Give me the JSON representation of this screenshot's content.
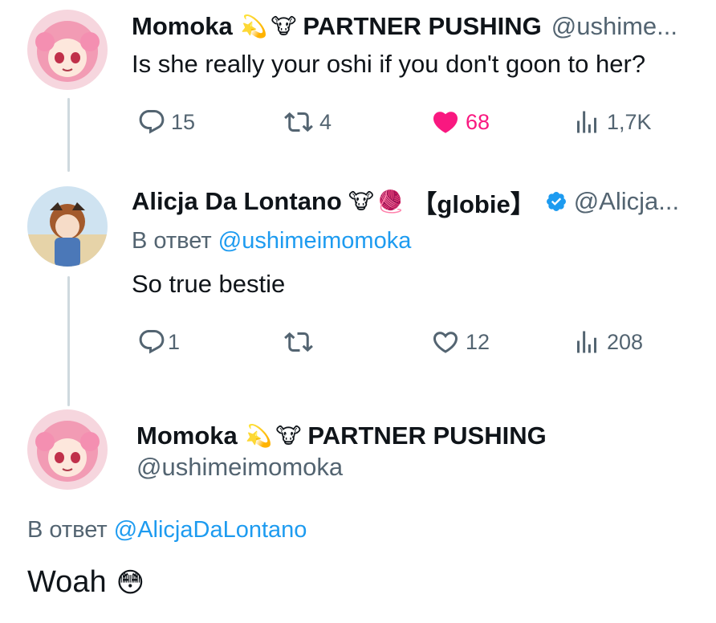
{
  "tweets": [
    {
      "author": {
        "name": "Momoka",
        "name_suffix": "PARTNER PUSHING",
        "handle": "@ushime..."
      },
      "text": "Is she really your oshi if you don't goon to her?",
      "stats": {
        "replies": "15",
        "retweets": "4",
        "likes": "68",
        "views": "1,7K"
      },
      "liked": true
    },
    {
      "author": {
        "name": "Alicja Da Lontano",
        "name_suffix": "【globie】",
        "handle": "@Alicja..."
      },
      "reply_prefix": "В ответ",
      "reply_mention": "@ushimeimomoka",
      "text": "So true bestie",
      "stats": {
        "replies": "1",
        "retweets": "",
        "likes": "12",
        "views": "208"
      },
      "liked": false
    },
    {
      "author": {
        "name": "Momoka",
        "name_suffix": "PARTNER PUSHING",
        "handle": "@ushimeimomoka"
      },
      "reply_prefix": "В ответ",
      "reply_mention": "@AlicjaDaLontano",
      "text": "Woah"
    }
  ],
  "icons": {
    "star_emoji": "💫",
    "cow_emoji": "🐮",
    "yarn_emoji": "🧶",
    "flushed_emoji": "😳"
  },
  "colors": {
    "accent": "#1d9bf0",
    "like": "#f91880",
    "secondary_text": "#536471",
    "thread_line": "#cfd9de"
  }
}
